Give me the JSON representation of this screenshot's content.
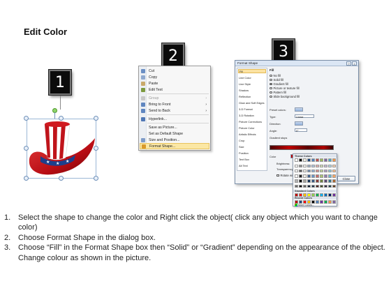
{
  "title": "Edit Color",
  "steps": [
    {
      "number": "1"
    },
    {
      "number": "2"
    },
    {
      "number": "3"
    }
  ],
  "context_menu": {
    "items": [
      {
        "label": "Cut",
        "icon": "scissors-icon"
      },
      {
        "label": "Copy",
        "icon": "copy-icon"
      },
      {
        "label": "Paste",
        "icon": "paste-icon"
      },
      {
        "label": "Edit Text",
        "icon": "edit-text-icon"
      },
      {
        "label": "Group",
        "icon": "group-icon",
        "submenu": true
      },
      {
        "label": "Bring to Front",
        "icon": "bring-front-icon",
        "submenu": true
      },
      {
        "label": "Send to Back",
        "icon": "send-back-icon",
        "submenu": true
      },
      {
        "label": "Hyperlink...",
        "icon": "hyperlink-icon"
      },
      {
        "label": "Save as Picture...",
        "icon": ""
      },
      {
        "label": "Set as Default Shape",
        "icon": ""
      },
      {
        "label": "Size and Position...",
        "icon": "size-position-icon"
      },
      {
        "label": "Format Shape...",
        "icon": "format-shape-icon",
        "highlighted": true
      }
    ]
  },
  "format_shape_dialog": {
    "title": "Format Shape",
    "left_panel": [
      "Fill",
      "Line Color",
      "Line Style",
      "Shadow",
      "Reflection",
      "Glow and Soft Edges",
      "3-D Format",
      "3-D Rotation",
      "Picture Corrections",
      "Picture Color",
      "Artistic Effects",
      "Crop",
      "Size",
      "Position",
      "Text Box",
      "Alt Text"
    ],
    "section_title": "Fill",
    "fill_options": [
      {
        "label": "No fill",
        "selected": false
      },
      {
        "label": "Solid fill",
        "selected": false
      },
      {
        "label": "Gradient fill",
        "selected": true
      },
      {
        "label": "Picture or texture fill",
        "selected": false
      },
      {
        "label": "Pattern fill",
        "selected": false
      },
      {
        "label": "Slide background fill",
        "selected": false
      }
    ],
    "preset_colors_label": "Preset colors:",
    "type_label": "Type:",
    "type_value": "Linear",
    "direction_label": "Direction:",
    "angle_label": "Angle:",
    "angle_value": "0°",
    "gradient_stops_label": "Gradient stops",
    "color_label": "Color",
    "position_label": "Position:",
    "position_value": "0%",
    "brightness_label": "Brightness:",
    "transparency_label": "Transparency:",
    "rotate_label": "Rotate with shape",
    "palette": {
      "theme_label": "Theme Colors",
      "standard_label": "Standard Colors",
      "recent_label": "Recent Colors",
      "more_label": "More Colors..."
    },
    "close_label": "Close"
  },
  "instructions": [
    {
      "num": "1.",
      "text": "Select the shape to change the color and Right click the object( click any object which you want to change color)"
    },
    {
      "num": "2.",
      "text": "Choose Format Shape in the dialog box."
    },
    {
      "num": "3.",
      "text": "Choose “Fill” in the Format Shape box then “Solid” or “Gradient” depending on the appearance of the object. Change colour as shown in the picture."
    }
  ],
  "colors": {
    "hat_red": "#c0141b",
    "hat_band_blue": "#1d3f8c",
    "highlight": "#fbe7a4",
    "step_box": "#0b0b0b"
  }
}
